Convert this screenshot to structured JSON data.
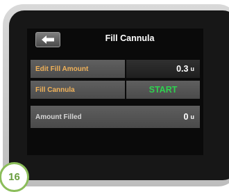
{
  "header": {
    "title": "Fill Cannula",
    "back_icon": "left-arrow-icon"
  },
  "rows": [
    {
      "label": "Edit Fill Amount",
      "value": "0.3",
      "unit": "u"
    },
    {
      "label": "Fill Cannula",
      "value": "START"
    },
    {
      "label": "Amount Filled",
      "value": "0",
      "unit": "u"
    }
  ],
  "badge": {
    "number": "16"
  },
  "colors": {
    "label_orange": "#f0b25a",
    "start_green": "#2ed24f",
    "badge_green": "#8bbd5a"
  }
}
